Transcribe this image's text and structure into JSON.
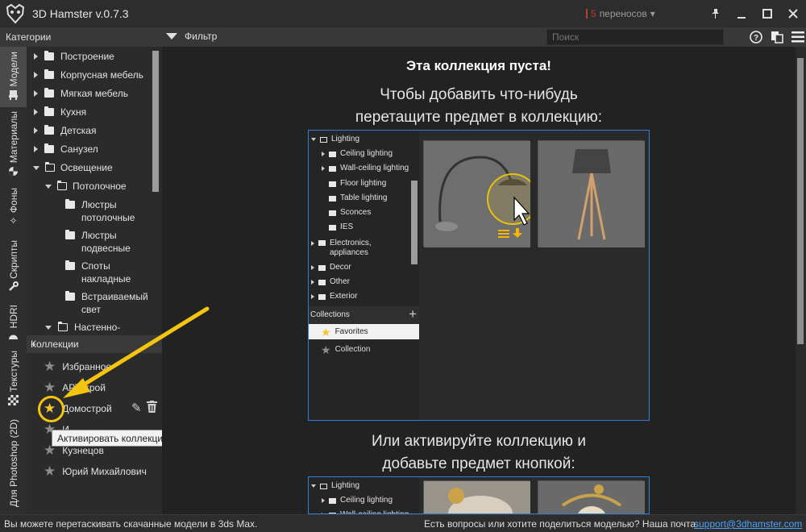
{
  "window": {
    "title": "3D Hamster v.0.7.3"
  },
  "titlebar": {
    "transfers_count": "5",
    "transfers_text": "переносов"
  },
  "header": {
    "categories_label": "Категории",
    "filter_label": "Фильтр",
    "search_placeholder": "Поиск"
  },
  "vertical_tabs": [
    "Модели",
    "Материалы",
    "Фоны",
    "Скрипты",
    "HDRI",
    "Текстуры",
    "Для Photoshop (2D)"
  ],
  "tree": [
    {
      "label": "Построение"
    },
    {
      "label": "Корпусная мебель"
    },
    {
      "label": "Мягкая мебель"
    },
    {
      "label": "Кухня"
    },
    {
      "label": "Детская"
    },
    {
      "label": "Санузел"
    },
    {
      "label": "Освещение"
    },
    {
      "label": "Потолочное"
    },
    {
      "label": "Люстры потолочные",
      "line1": "Люстры",
      "line2": "потолочные"
    },
    {
      "label": "Люстры подвесные",
      "line1": "Люстры",
      "line2": "подвесные"
    },
    {
      "label": "Споты накладные",
      "line1": "Споты",
      "line2": "накладные"
    },
    {
      "label": "Встраиваемый свет",
      "line1": "Встраиваемый",
      "line2": "свет"
    },
    {
      "label": "Настенно-"
    }
  ],
  "collections": {
    "title": "Коллекции",
    "items": [
      "Избранное",
      "АРТстрой",
      "Домострой",
      "И",
      "Кузнецов",
      "Юрий Михайлович"
    ],
    "tooltip": "Активировать коллекцию"
  },
  "main": {
    "empty_title": "Эта коллекция пуста!",
    "drag_line1": "Чтобы добавить что-нибудь",
    "drag_line2": "перетащите предмет в коллекцию:",
    "or_line1": "Или активируйте коллекцию и",
    "or_line2": "добавьте предмет кнопкой:"
  },
  "demo": {
    "tree": [
      "Lighting",
      "Ceiling lighting",
      "Wall-ceiling lighting",
      "Floor lighting",
      "Table lighting",
      "Sconces",
      "IES",
      "Electronics,",
      "appliances",
      "Decor",
      "Other",
      "Exterior"
    ],
    "collections_title": "Collections",
    "collections": [
      "Favorites",
      "Collection"
    ]
  },
  "statusbar": {
    "left": "Вы можете перетаскивать скачанные модели в 3ds Max.",
    "right": "Есть вопросы или хотите поделиться моделью? Наша почта:",
    "email": "support@3dhamster.com"
  },
  "colors": {
    "accent_blue": "#2f7fd4",
    "gold": "#f4c40f",
    "alert_red": "#c0392b"
  }
}
